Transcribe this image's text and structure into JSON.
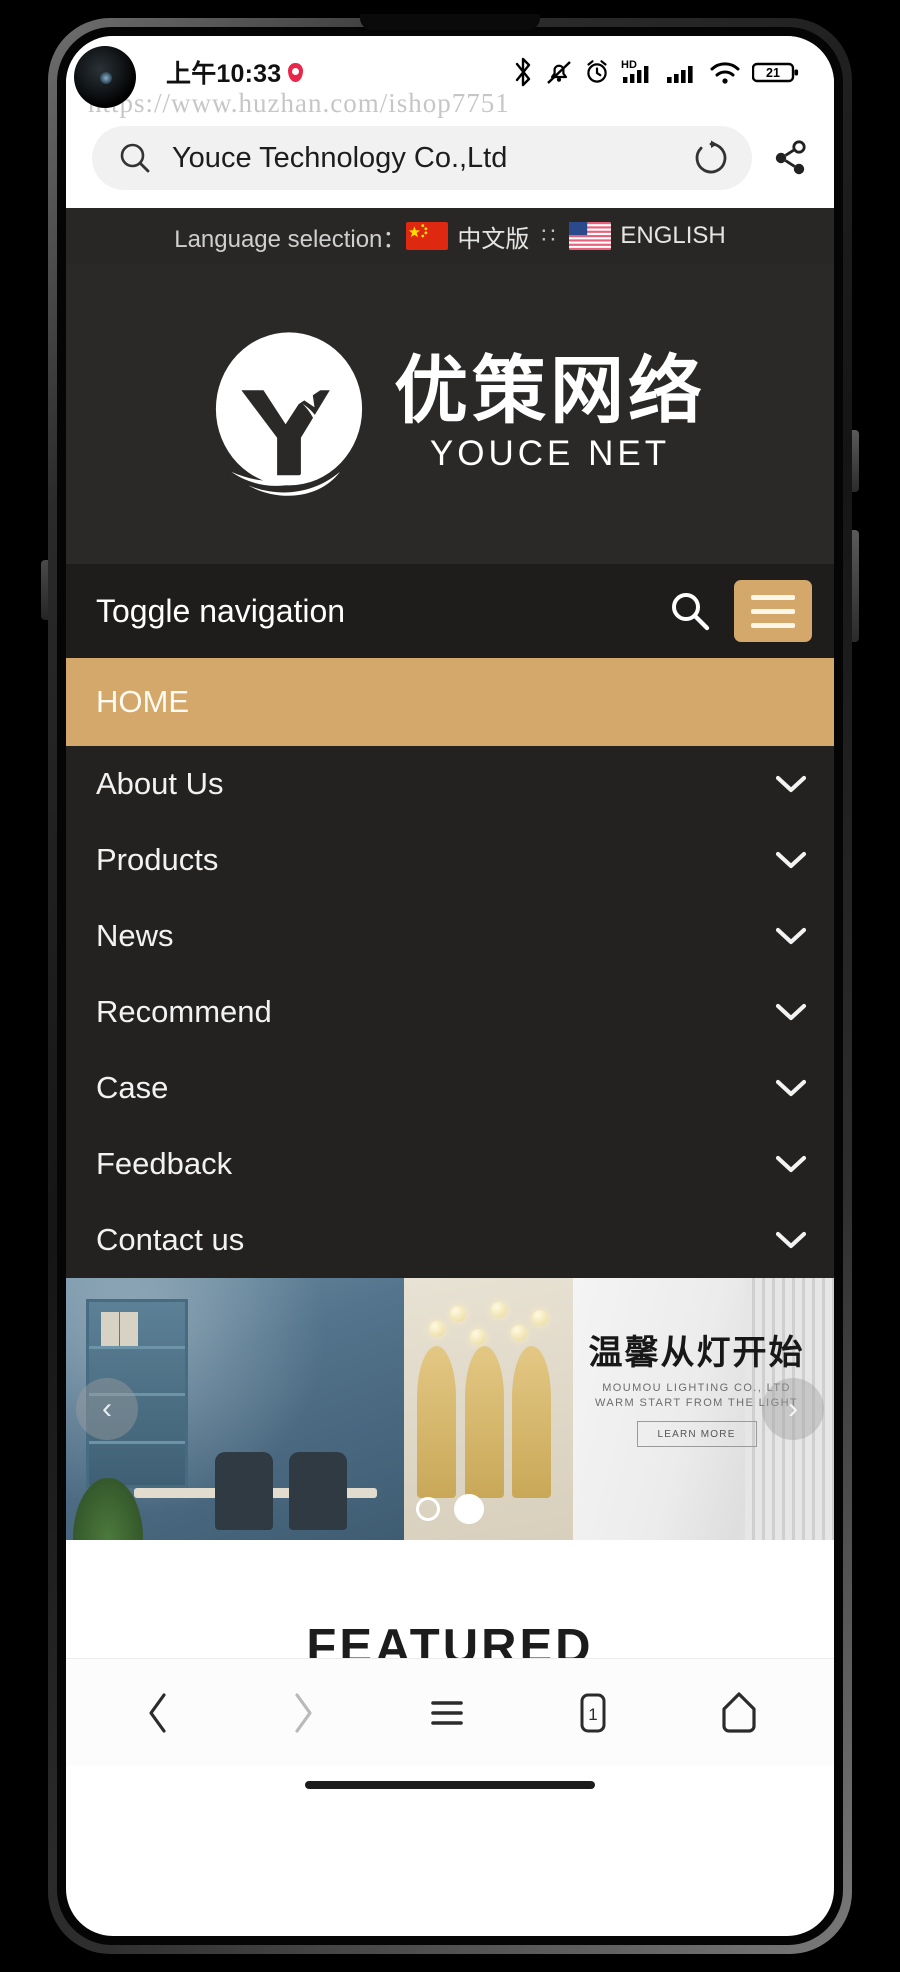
{
  "watermark": "https://www.huzhan.com/ishop7751",
  "status_bar": {
    "time": "上午10:33",
    "battery": "21",
    "icons": [
      "location-pin-icon",
      "bluetooth-icon",
      "mute-vibrate-icon",
      "alarm-clock-icon",
      "hd-icon",
      "signal-bars-icon",
      "signal-bars-2-icon",
      "wifi-icon",
      "battery-icon"
    ]
  },
  "browser": {
    "page_title": "Youce Technology Co.,Ltd",
    "search_icon": "search-icon",
    "reload_icon": "reload-icon",
    "share_icon": "share-icon"
  },
  "site": {
    "language_bar": {
      "label": "Language selection：",
      "separator": "∷",
      "options": [
        {
          "label": "中文版",
          "flag": "china-flag"
        },
        {
          "label": "ENGLISH",
          "flag": "usa-flag"
        }
      ]
    },
    "logo": {
      "cn": "优策网络",
      "en": "YOUCE NET",
      "mark": "youce-y-logo"
    },
    "navbar": {
      "toggle_label": "Toggle navigation",
      "search_icon": "search-icon",
      "menu_icon": "hamburger-icon",
      "accent_color": "#d3a86a"
    },
    "menu": [
      {
        "label": "HOME",
        "active": true,
        "has_children": false
      },
      {
        "label": "About Us",
        "active": false,
        "has_children": true
      },
      {
        "label": "Products",
        "active": false,
        "has_children": true
      },
      {
        "label": "News",
        "active": false,
        "has_children": true
      },
      {
        "label": "Recommend",
        "active": false,
        "has_children": true
      },
      {
        "label": "Case",
        "active": false,
        "has_children": true
      },
      {
        "label": "Feedback",
        "active": false,
        "has_children": true
      },
      {
        "label": "Contact us",
        "active": false,
        "has_children": true
      }
    ],
    "carousel": {
      "headline_cn": "温馨从灯开始",
      "sub_line1": "MOUMOU LIGHTING CO., LTD",
      "sub_line2": "WARM START FROM THE LIGHT",
      "cta_label": "LEARN MORE",
      "prev_label": "‹",
      "next_label": "›",
      "slides": 2,
      "active_slide": 2
    },
    "featured_heading": "FEATURED"
  },
  "system_nav": {
    "items": [
      {
        "name": "back-button",
        "glyph": "‹"
      },
      {
        "name": "forward-button",
        "glyph": "›"
      },
      {
        "name": "menu-button",
        "glyph": "≡"
      },
      {
        "name": "tabs-button",
        "glyph": "1"
      },
      {
        "name": "home-button",
        "glyph": "⌂"
      }
    ]
  }
}
